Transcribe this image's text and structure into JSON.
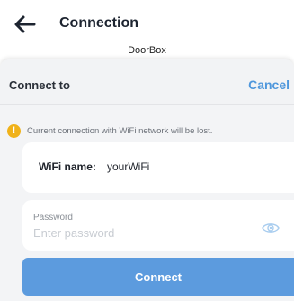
{
  "header": {
    "back_icon": "arrow-left-icon",
    "title": "Connection",
    "device_name": "DoorBox"
  },
  "sheet": {
    "title": "Connect to",
    "cancel_label": "Cancel",
    "warning": {
      "icon": "exclamation-circle-icon",
      "text": "Current connection with WiFi network will be lost."
    },
    "wifi": {
      "label": "WiFi name:",
      "value": "yourWiFi"
    },
    "password": {
      "label": "Password",
      "placeholder": "Enter password",
      "value": "",
      "eye_icon": "eye-icon"
    },
    "connect_label": "Connect"
  },
  "colors": {
    "accent": "#5c9bde",
    "cancel": "#4f97dc",
    "warning": "#f0b21a",
    "sheet_background": "#f3f4f6"
  }
}
